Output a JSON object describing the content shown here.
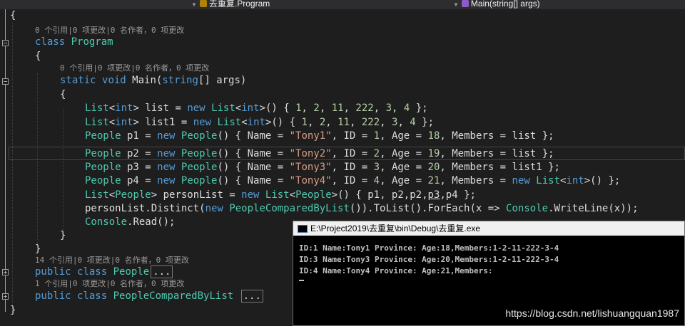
{
  "navbar": {
    "class_selector": "去重复.Program",
    "member_selector": "Main(string[] args)",
    "class_icon": "class-icon",
    "member_icon": "method-icon"
  },
  "code": {
    "open_brace": "{",
    "close_brace": "}",
    "lens_program": "0 个引用|0 项更改|0 名作者，0 项更改",
    "class_kw": "class",
    "class_name": "Program",
    "lens_main": "0 个引用|0 项更改|0 名作者，0 项更改",
    "static_kw": "static",
    "void_kw": "void",
    "main_name": "Main(",
    "string_kw": "string",
    "main_params": "[] args)",
    "list_decl": {
      "type": "List",
      "lt": "<",
      "int": "int",
      "gt": ">",
      "rest1": " list = ",
      "new": "new",
      "type2": "List",
      "int2": "int",
      "rest2": "() { ",
      "n1": "1",
      "n2": "2",
      "n3": "11",
      "n4": "222",
      "n5": "3",
      "n6": "4",
      "end": " };"
    },
    "list1_decl": {
      "type": "List",
      "int": "int",
      "rest1": " list1 = ",
      "new": "new",
      "type2": "List",
      "int2": "int",
      "rest2": "() { ",
      "n1": "1",
      "n2": "2",
      "n3": "11",
      "n4": "222",
      "n5": "3",
      "n6": "4",
      "end": " };"
    },
    "people": [
      {
        "var": " p1 = ",
        "name": "\"Tony1\"",
        "id": "1",
        "age": "18",
        "members": "list",
        "members_new": false
      },
      {
        "var": " p2 = ",
        "name": "\"Tony2\"",
        "id": "2",
        "age": "19",
        "members": "list",
        "members_new": false
      },
      {
        "var": " p3 = ",
        "name": "\"Tony3\"",
        "id": "3",
        "age": "20",
        "members": "list1",
        "members_new": false
      },
      {
        "var": " p4 = ",
        "name": "\"Tony4\"",
        "id": "4",
        "age": "21",
        "members": "() };",
        "members_new": true
      }
    ],
    "people_type": "People",
    "person_list_line": {
      "list": "List",
      "people": "People",
      "mid": "> personList = ",
      "new": "new",
      "list2": "List",
      "people2": "People",
      "rest": ">() { p1, p2,p2,",
      "p3": "p3",
      "end": ",p4 };"
    },
    "distinct_line": {
      "a": "personList.Distinct(",
      "new": "new",
      "cls": "PeopleComparedByList",
      "b": "()).ToList().ForEach(x => ",
      "console": "Console",
      "c": ".WriteLine(x));"
    },
    "read_line": {
      "console": "Console",
      "rest": ".Read();"
    },
    "lens_people": "14 个引用|0 项更改|0 名作者，0 项更改",
    "public_kw": "public",
    "people_class_name": "People",
    "lens_comparer": "1 个引用|0 项更改|0 名作者，0 项更改",
    "comparer_class_name": "PeopleComparedByList",
    "collapsed": "..."
  },
  "console": {
    "title": "E:\\Project2019\\去重复\\bin\\Debug\\去重复.exe",
    "lines": [
      "ID:1 Name:Tony1 Province: Age:18,Members:1-2-11-222-3-4",
      "ID:3 Name:Tony3 Province: Age:20,Members:1-2-11-222-3-4",
      "ID:4 Name:Tony4 Province: Age:21,Members:"
    ]
  },
  "watermark": "https://blog.csdn.net/lishuangquan1987"
}
